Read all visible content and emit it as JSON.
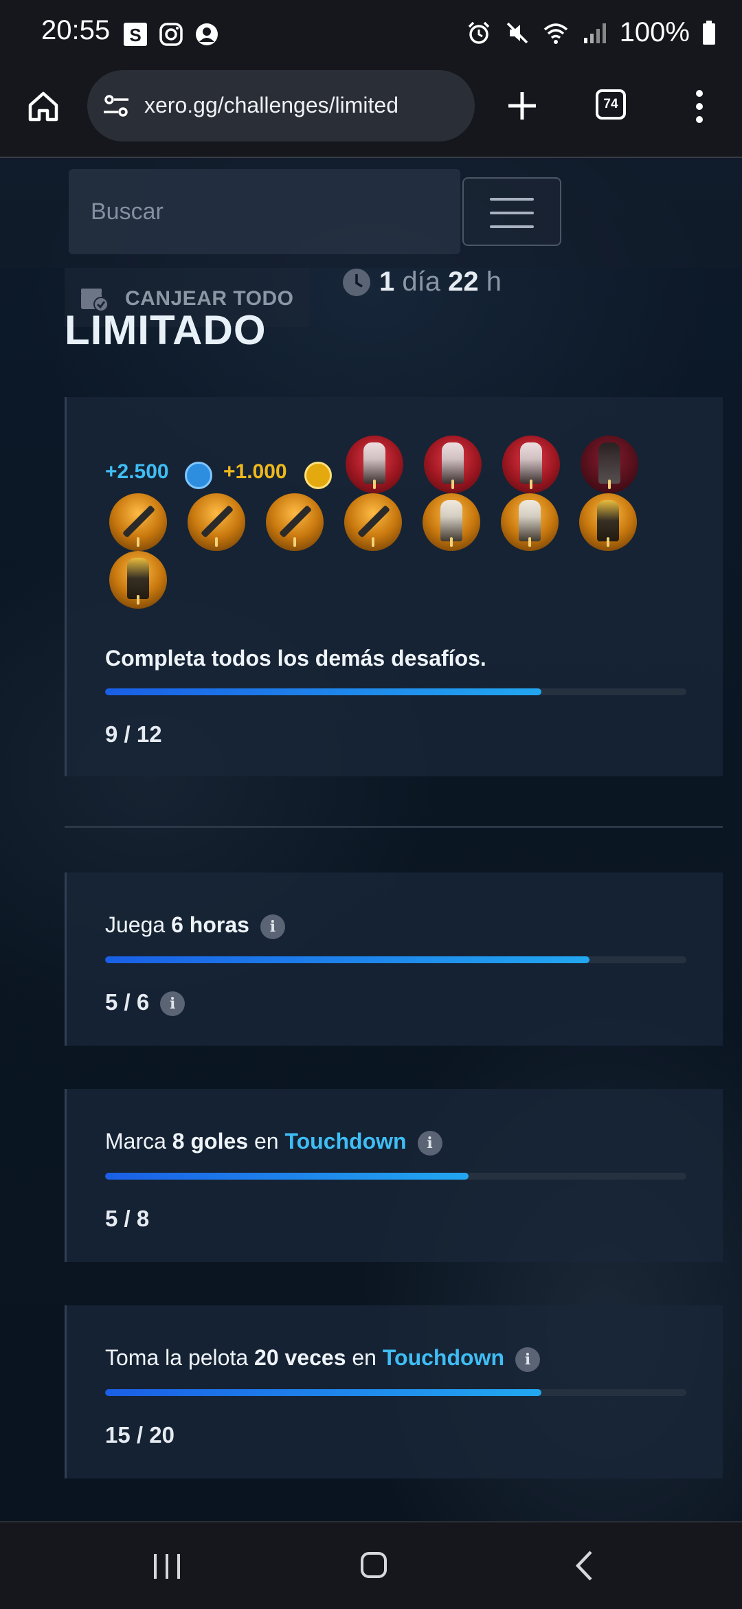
{
  "status_bar": {
    "time": "20:55",
    "battery": "100%"
  },
  "browser": {
    "url": "xero.gg/challenges/limited",
    "tab_count": "74"
  },
  "header": {
    "search_placeholder": "Buscar",
    "redeem_label": "CANJEAR TODO",
    "timer": {
      "days": "1",
      "days_unit": "día",
      "hours": "22",
      "hours_unit": "h"
    }
  },
  "page_title": "LIMITADO",
  "main_challenge": {
    "points_reward": "+2.500",
    "zen_reward": "+1.000",
    "description": "Completa todos los demás desafíos.",
    "progress": "9 / 12",
    "progress_fraction": 0.75
  },
  "challenges": [
    {
      "prefix": "Juega ",
      "bold": "6 horas",
      "suffix": "",
      "highlight": "",
      "progress": "5 / 6",
      "progress_fraction": 0.8333
    },
    {
      "prefix": "Marca ",
      "bold": "8 goles",
      "suffix": " en ",
      "highlight": "Touchdown",
      "progress": "5 / 8",
      "progress_fraction": 0.625
    },
    {
      "prefix": "Toma la pelota ",
      "bold": "20 veces",
      "suffix": " en ",
      "highlight": "Touchdown",
      "progress": "15 / 20",
      "progress_fraction": 0.75
    }
  ],
  "colors": {
    "accent": "#3fbdf4",
    "points": "#3fbdf4",
    "zen": "#f0b81c"
  }
}
